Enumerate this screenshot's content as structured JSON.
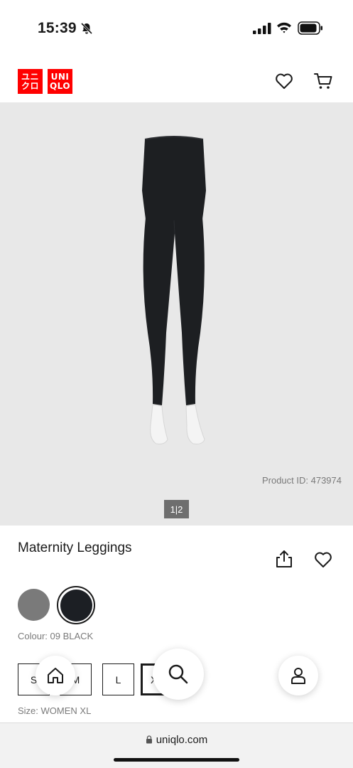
{
  "status_bar": {
    "time": "15:39"
  },
  "header": {
    "logo_left": [
      "ユニ",
      "クロ"
    ],
    "logo_right": [
      "UNI",
      "QLO"
    ],
    "brand_color": "#ff0000",
    "icons": [
      "heart-icon",
      "cart-icon"
    ]
  },
  "hero": {
    "background": "#e8e8e8",
    "product_id": "Product ID: 473974",
    "pager": "1|2"
  },
  "product": {
    "title": "Maternity Leggings",
    "colours": [
      {
        "name": "gray",
        "hex": "#7a7a7a",
        "selected": false
      },
      {
        "name": "black",
        "hex": "#1c1f24",
        "selected": true
      }
    ],
    "colour_label": "Colour: 09 BLACK",
    "sizes": [
      "S",
      "M",
      "L",
      "XL"
    ],
    "selected_size": "XL",
    "size_label": "Size: WOMEN XL"
  },
  "floating_nav": [
    "home-icon",
    "search-icon",
    "account-icon"
  ],
  "browser": {
    "url": "uniqlo.com"
  }
}
